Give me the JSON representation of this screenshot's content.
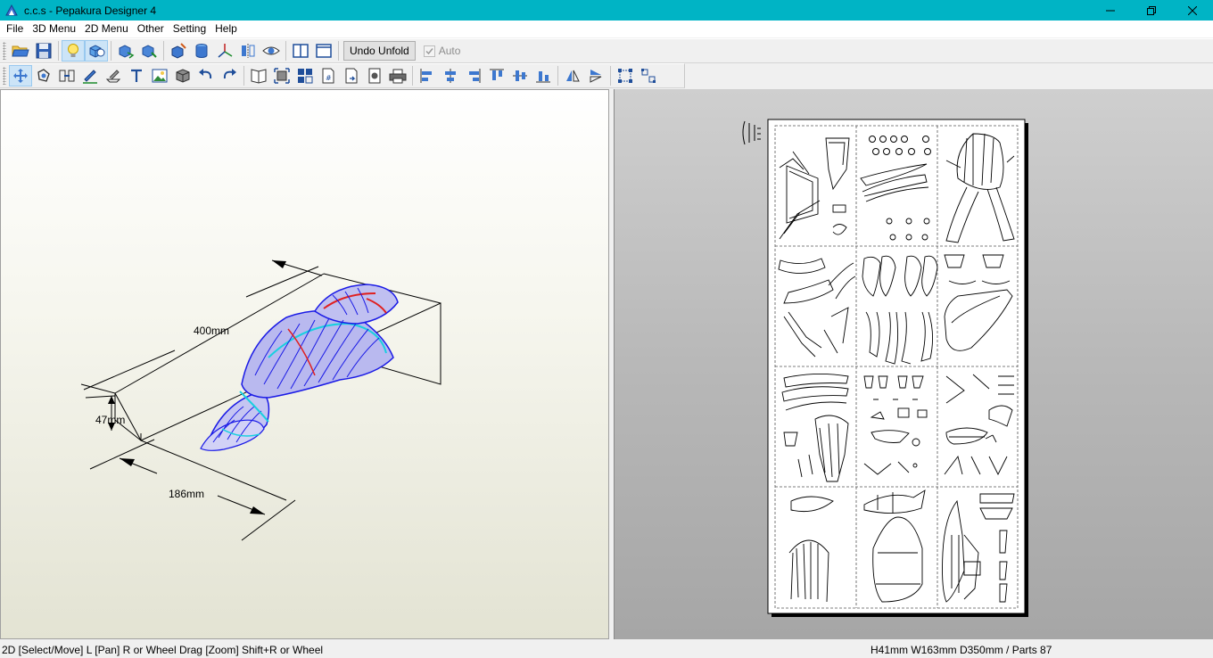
{
  "window": {
    "title": "c.c.s - Pepakura Designer 4"
  },
  "menu": [
    {
      "key": "file",
      "label": "File"
    },
    {
      "key": "3d-menu",
      "label": "3D Menu"
    },
    {
      "key": "2d-menu",
      "label": "2D Menu"
    },
    {
      "key": "other",
      "label": "Other"
    },
    {
      "key": "setting",
      "label": "Setting"
    },
    {
      "key": "help",
      "label": "Help"
    }
  ],
  "toolbar1": {
    "undo_unfold": "Undo Unfold",
    "auto_label": "Auto",
    "auto_checked": true
  },
  "view3d": {
    "dim_length": "400mm",
    "dim_height": "47mm",
    "dim_width": "186mm"
  },
  "status": {
    "hint": "2D [Select/Move] L [Pan] R or Wheel Drag [Zoom] Shift+R or Wheel",
    "info": "H41mm W163mm D350mm / Parts 87"
  },
  "colors": {
    "titlebar": "#00b4c5",
    "model_edges": "#1a1ae6",
    "model_fill": "#c8c8f5",
    "model_seam": "#19d0e0",
    "model_cut": "#e02020"
  }
}
